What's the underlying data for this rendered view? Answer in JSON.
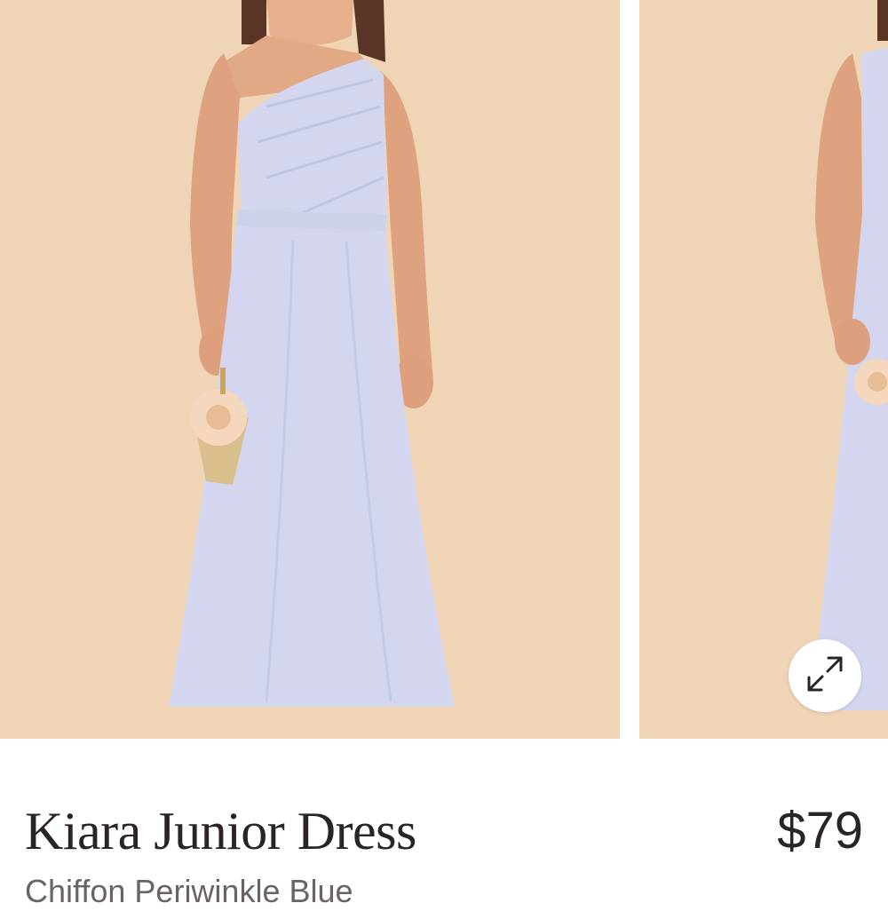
{
  "product": {
    "name": "Kiara Junior Dress",
    "price": "$79",
    "subtitle": "Chiffon Periwinkle Blue"
  },
  "gallery": {
    "images": [
      {
        "alt": "Kiara Junior Dress front view"
      },
      {
        "alt": "Kiara Junior Dress alternate view"
      }
    ],
    "expand_icon": "expand-arrows-icon"
  },
  "colors": {
    "backdrop": "#efd4b6",
    "dress": "#d3d6ee",
    "text": "#2b2424"
  }
}
